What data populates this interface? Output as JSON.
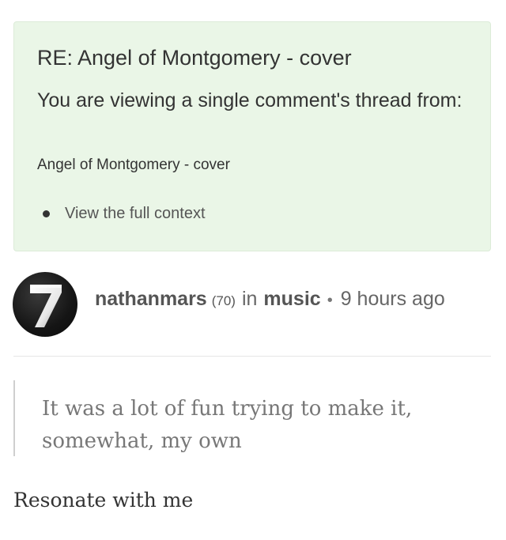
{
  "thread": {
    "title": "RE: Angel of Montgomery - cover",
    "notice": "You are viewing a single comment's thread from:",
    "parent_post": "Angel of Montgomery - cover",
    "context_link": "View the full context"
  },
  "comment": {
    "avatar_glyph": "7",
    "author": "nathanmars",
    "reputation": "(70)",
    "in_label": "in",
    "community": "music",
    "separator": "•",
    "time_ago": "9 hours ago",
    "quote": "It was a lot of fun trying to make it, somewhat, my own",
    "body": "Resonate with me"
  },
  "colors": {
    "thread_box_bg": "#eaf6e7",
    "text_dark": "#333333",
    "text_muted": "#777777"
  }
}
